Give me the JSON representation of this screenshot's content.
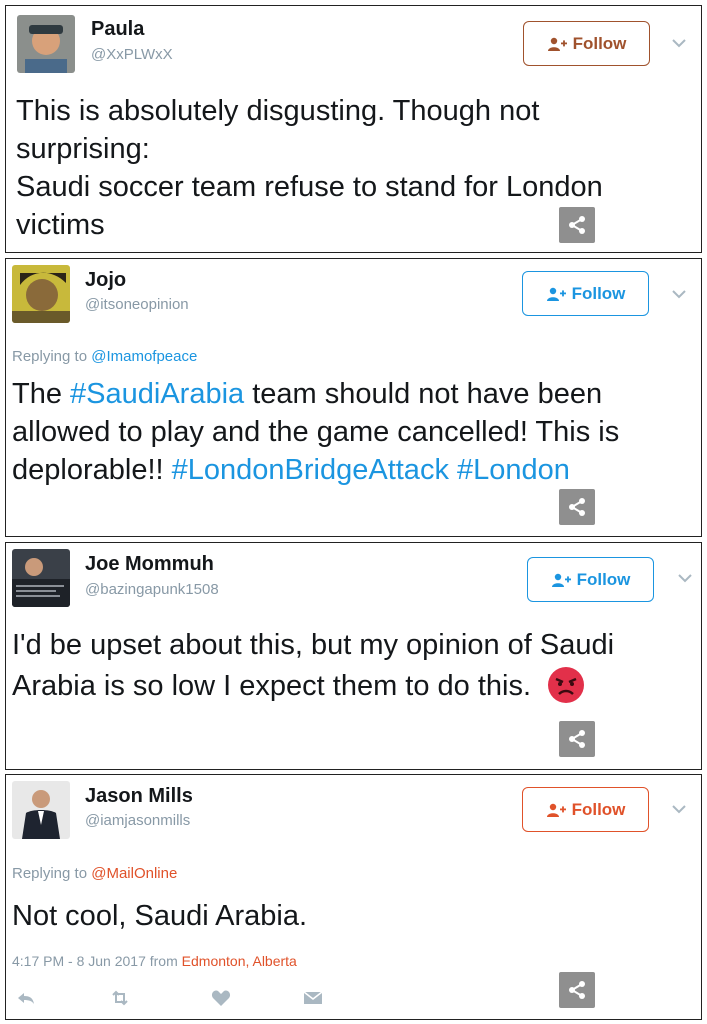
{
  "tweets": [
    {
      "name": "Paula",
      "handle": "@XxPLWxX",
      "follow_label": "Follow",
      "follow_color": "#a0522d",
      "text": "This is absolutely disgusting. Though not surprising:\nSaudi soccer team refuse to stand for London victims"
    },
    {
      "name": "Jojo",
      "handle": "@itsoneopinion",
      "follow_label": "Follow",
      "follow_color": "#1b95e0",
      "reply_prefix": "Replying to",
      "reply_to": "@Imamofpeace",
      "text_parts": [
        {
          "t": "The ",
          "link": false
        },
        {
          "t": "#SaudiArabia",
          "link": true
        },
        {
          "t": " team should not have been allowed to play and the game cancelled! This is deplorable!! ",
          "link": false
        },
        {
          "t": "#LondonBridgeAttack",
          "link": true
        },
        {
          "t": " ",
          "link": false
        },
        {
          "t": "#London",
          "link": true
        }
      ]
    },
    {
      "name": "Joe Mommuh",
      "handle": "@bazingapunk1508",
      "follow_label": "Follow",
      "follow_color": "#1b95e0",
      "text": "I'd be upset about this, but my opinion of Saudi Arabia is so low I expect them to do this.",
      "emoji": "angry-face"
    },
    {
      "name": "Jason Mills",
      "handle": "@iamjasonmills",
      "follow_label": "Follow",
      "follow_color": "#e0522a",
      "reply_prefix": "Replying to",
      "reply_to": "@MailOnline",
      "text": "Not cool, Saudi Arabia.",
      "time": "4:17 PM - 8 Jun 2017 from",
      "location": "Edmonton, Alberta"
    }
  ],
  "colors": {
    "link": "#1b95e0",
    "location": "#e0522a",
    "muted": "#8899a6"
  },
  "icons": [
    "person-add-icon",
    "chevron-down-icon",
    "share-icon",
    "reply-icon",
    "retweet-icon",
    "heart-icon",
    "message-icon"
  ]
}
